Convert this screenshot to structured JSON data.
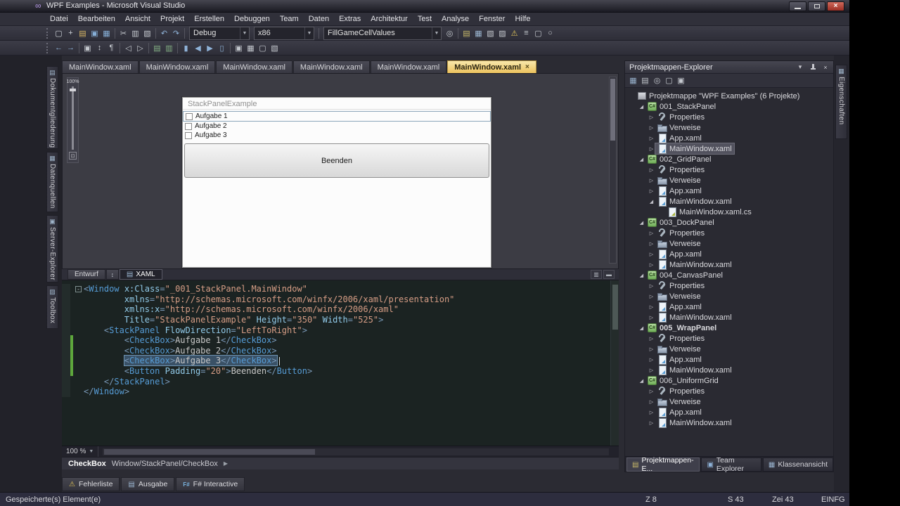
{
  "titlebar": {
    "title": "WPF Examples - Microsoft Visual Studio"
  },
  "menu": {
    "items": [
      "Datei",
      "Bearbeiten",
      "Ansicht",
      "Projekt",
      "Erstellen",
      "Debuggen",
      "Team",
      "Daten",
      "Extras",
      "Architektur",
      "Test",
      "Analyse",
      "Fenster",
      "Hilfe"
    ]
  },
  "toolbar1": {
    "left_icons": [
      {
        "name": "new-project-icon",
        "glyph": "▢",
        "color": "#cdd2d8"
      },
      {
        "name": "add-item-icon",
        "glyph": "+",
        "color": "#cdd2d8"
      },
      {
        "name": "open-file-icon",
        "glyph": "▤",
        "color": "#d9b765"
      },
      {
        "name": "save-icon",
        "glyph": "▣",
        "color": "#86aed6"
      },
      {
        "name": "save-all-icon",
        "glyph": "▦",
        "color": "#86aed6"
      },
      {
        "sep": true
      },
      {
        "name": "cut-icon",
        "glyph": "✂",
        "color": "#c4c8ce"
      },
      {
        "name": "copy-icon",
        "glyph": "▥",
        "color": "#c4c8ce"
      },
      {
        "name": "paste-icon",
        "glyph": "▧",
        "color": "#c4c8ce"
      },
      {
        "sep": true
      },
      {
        "name": "undo-icon",
        "glyph": "↶",
        "color": "#8fb3d9"
      },
      {
        "name": "redo-icon",
        "glyph": "↷",
        "color": "#8fb3d9"
      },
      {
        "sep": true
      }
    ],
    "debug_combo": "Debug",
    "platform_combo": "x86",
    "member_combo": "FillGameCellValues",
    "combo_arrow": "▼",
    "right_icons": [
      {
        "name": "find-in-files-icon",
        "glyph": "◎",
        "color": "#c4c8ce"
      },
      {
        "sep": true
      },
      {
        "name": "solution-explorer-icon",
        "glyph": "▤",
        "color": "#c9b96a"
      },
      {
        "name": "properties-window-icon",
        "glyph": "▦",
        "color": "#9ab4cf"
      },
      {
        "name": "object-browser-icon",
        "glyph": "▧",
        "color": "#c4c8ce"
      },
      {
        "name": "toolbox-icon",
        "glyph": "▨",
        "color": "#c4c8ce"
      },
      {
        "name": "error-list-icon",
        "glyph": "⚠",
        "color": "#e0c35a"
      },
      {
        "name": "output-window-icon",
        "glyph": "≡",
        "color": "#c4c8ce"
      },
      {
        "name": "immediate-window-icon",
        "glyph": "▢",
        "color": "#c4c8ce"
      },
      {
        "name": "start-page-icon",
        "glyph": "○",
        "color": "#c4c8ce"
      }
    ]
  },
  "toolbar2": {
    "icons": [
      {
        "name": "navigate-backward-icon",
        "glyph": "←",
        "color": "#8fb3d9"
      },
      {
        "name": "navigate-forward-icon",
        "glyph": "→",
        "color": "#8fb3d9"
      },
      {
        "sep": true
      },
      {
        "name": "display-in-browser-icon",
        "glyph": "▣",
        "color": "#c4c8ce"
      },
      {
        "name": "word-wrap-icon",
        "glyph": "↕",
        "color": "#c4c8ce"
      },
      {
        "name": "show-whitespace-icon",
        "glyph": "¶",
        "color": "#c4c8ce"
      },
      {
        "sep": true
      },
      {
        "name": "decrease-indent-icon",
        "glyph": "◁",
        "color": "#c4c8ce"
      },
      {
        "name": "increase-indent-icon",
        "glyph": "▷",
        "color": "#c4c8ce"
      },
      {
        "sep": true
      },
      {
        "name": "comment-icon",
        "glyph": "▤",
        "color": "#85b285"
      },
      {
        "name": "uncomment-icon",
        "glyph": "▥",
        "color": "#85b285"
      },
      {
        "sep": true
      },
      {
        "name": "toggle-bookmark-icon",
        "glyph": "▮",
        "color": "#8fb3d9"
      },
      {
        "name": "previous-bookmark-icon",
        "glyph": "◀",
        "color": "#8fb3d9"
      },
      {
        "name": "next-bookmark-icon",
        "glyph": "▶",
        "color": "#8fb3d9"
      },
      {
        "name": "clear-bookmarks-icon",
        "glyph": "▯",
        "color": "#8fb3d9"
      },
      {
        "sep": true
      },
      {
        "name": "intellisense-icon",
        "glyph": "▣",
        "color": "#c4c8ce"
      },
      {
        "name": "parameter-info-icon",
        "glyph": "▦",
        "color": "#c4c8ce"
      },
      {
        "name": "quick-info-icon",
        "glyph": "▢",
        "color": "#c4c8ce"
      },
      {
        "name": "word-completion-icon",
        "glyph": "▧",
        "color": "#c4c8ce"
      }
    ]
  },
  "doc_tabs": [
    {
      "label": "MainWindow.xaml",
      "active": false
    },
    {
      "label": "MainWindow.xaml",
      "active": false
    },
    {
      "label": "MainWindow.xaml",
      "active": false
    },
    {
      "label": "MainWindow.xaml",
      "active": false
    },
    {
      "label": "MainWindow.xaml",
      "active": false
    },
    {
      "label": "MainWindow.xaml",
      "active": true,
      "close": "×"
    }
  ],
  "designer": {
    "zoom_label": "100%",
    "fit_glyph": "⊡",
    "preview": {
      "title": "StackPanelExample",
      "checkboxes": [
        "Aufgabe 1",
        "Aufgabe 2",
        "Aufgabe 3"
      ],
      "button": "Beenden"
    }
  },
  "editor": {
    "design_tab": "Entwurf",
    "swap_glyph": "↕",
    "xaml_tab": "XAML",
    "zoom": "100 %",
    "breadcrumb": {
      "current": "CheckBox",
      "path": "Window/StackPanel/CheckBox",
      "chevron": "▶"
    },
    "code": [
      {
        "fold": "-",
        "tokens": [
          {
            "c": "d",
            "t": "<"
          },
          {
            "c": "e",
            "t": "Window"
          },
          {
            "c": "p",
            "t": " "
          },
          {
            "c": "a",
            "t": "x:Class"
          },
          {
            "c": "d",
            "t": "="
          },
          {
            "c": "s",
            "t": "\"_001_StackPanel.MainWindow\""
          }
        ]
      },
      {
        "tokens": [
          {
            "c": "p",
            "t": "        "
          },
          {
            "c": "a",
            "t": "xmlns"
          },
          {
            "c": "d",
            "t": "="
          },
          {
            "c": "s",
            "t": "\"http://schemas.microsoft.com/winfx/2006/xaml/presentation\""
          }
        ]
      },
      {
        "tokens": [
          {
            "c": "p",
            "t": "        "
          },
          {
            "c": "a",
            "t": "xmlns:x"
          },
          {
            "c": "d",
            "t": "="
          },
          {
            "c": "s",
            "t": "\"http://schemas.microsoft.com/winfx/2006/xaml\""
          }
        ]
      },
      {
        "tokens": [
          {
            "c": "p",
            "t": "        "
          },
          {
            "c": "a",
            "t": "Title"
          },
          {
            "c": "d",
            "t": "="
          },
          {
            "c": "s",
            "t": "\"StackPanelExample\""
          },
          {
            "c": "p",
            "t": " "
          },
          {
            "c": "a",
            "t": "Height"
          },
          {
            "c": "d",
            "t": "="
          },
          {
            "c": "s",
            "t": "\"350\""
          },
          {
            "c": "p",
            "t": " "
          },
          {
            "c": "a",
            "t": "Width"
          },
          {
            "c": "d",
            "t": "="
          },
          {
            "c": "s",
            "t": "\"525\""
          },
          {
            "c": "d",
            "t": ">"
          }
        ]
      },
      {
        "tokens": [
          {
            "c": "p",
            "t": "    "
          },
          {
            "c": "d",
            "t": "<"
          },
          {
            "c": "e",
            "t": "StackPanel"
          },
          {
            "c": "p",
            "t": " "
          },
          {
            "c": "a",
            "t": "FlowDirection"
          },
          {
            "c": "d",
            "t": "="
          },
          {
            "c": "s",
            "t": "\"LeftToRight\""
          },
          {
            "c": "d",
            "t": ">"
          }
        ]
      },
      {
        "chg": true,
        "tokens": [
          {
            "c": "p",
            "t": "        "
          },
          {
            "c": "d",
            "t": "<"
          },
          {
            "c": "e",
            "t": "CheckBox"
          },
          {
            "c": "d",
            "t": ">"
          },
          {
            "c": "x",
            "t": "Aufgabe 1"
          },
          {
            "c": "d",
            "t": "</"
          },
          {
            "c": "e",
            "t": "CheckBox"
          },
          {
            "c": "d",
            "t": ">"
          }
        ]
      },
      {
        "chg": true,
        "tokens": [
          {
            "c": "p",
            "t": "        "
          },
          {
            "c": "d",
            "t": "<"
          },
          {
            "c": "e",
            "t": "CheckBox"
          },
          {
            "c": "d",
            "t": ">"
          },
          {
            "c": "x",
            "t": "Aufgabe 2"
          },
          {
            "c": "d",
            "t": "</"
          },
          {
            "c": "e",
            "t": "CheckBox"
          },
          {
            "c": "d",
            "t": ">"
          }
        ]
      },
      {
        "chg": true,
        "caret": true,
        "tokens": [
          {
            "c": "p",
            "t": "        "
          },
          {
            "c": "d",
            "t": "<",
            "sel": true
          },
          {
            "c": "e",
            "t": "CheckBox",
            "sel": true
          },
          {
            "c": "d",
            "t": ">",
            "sel": true
          },
          {
            "c": "x",
            "t": "Aufgabe 3",
            "sel": true
          },
          {
            "c": "d",
            "t": "</",
            "sel": true
          },
          {
            "c": "e",
            "t": "CheckBox",
            "sel": true
          },
          {
            "c": "d",
            "t": ">",
            "sel": true
          }
        ]
      },
      {
        "chg": true,
        "tokens": [
          {
            "c": "p",
            "t": "        "
          },
          {
            "c": "d",
            "t": "<"
          },
          {
            "c": "e",
            "t": "Button"
          },
          {
            "c": "p",
            "t": " "
          },
          {
            "c": "a",
            "t": "Padding"
          },
          {
            "c": "d",
            "t": "="
          },
          {
            "c": "s",
            "t": "\"20\""
          },
          {
            "c": "d",
            "t": ">"
          },
          {
            "c": "x",
            "t": "Beenden"
          },
          {
            "c": "d",
            "t": "</"
          },
          {
            "c": "e",
            "t": "Button"
          },
          {
            "c": "d",
            "t": ">"
          }
        ]
      },
      {
        "tokens": [
          {
            "c": "p",
            "t": "    "
          },
          {
            "c": "d",
            "t": "</"
          },
          {
            "c": "e",
            "t": "StackPanel"
          },
          {
            "c": "d",
            "t": ">"
          }
        ]
      },
      {
        "tokens": [
          {
            "c": "d",
            "t": "</"
          },
          {
            "c": "e",
            "t": "Window"
          },
          {
            "c": "d",
            "t": ">"
          }
        ]
      }
    ]
  },
  "solution_explorer": {
    "title": "Projektmappen-Explorer",
    "header_icons": {
      "dropdown": "▾",
      "close": "×"
    },
    "toolbar_icons": [
      {
        "name": "properties-icon",
        "glyph": "▦",
        "color": "#9ab4cf"
      },
      {
        "name": "show-all-files-icon",
        "glyph": "▤",
        "color": "#c4c8ce"
      },
      {
        "name": "refresh-icon",
        "glyph": "◎",
        "color": "#c4c8ce"
      },
      {
        "name": "view-code-icon",
        "glyph": "▢",
        "color": "#c4c8ce"
      },
      {
        "name": "view-designer-icon",
        "glyph": "▣",
        "color": "#c4c8ce"
      }
    ],
    "tree": [
      {
        "label": "Projektmappe \"WPF Examples\" (6 Projekte)",
        "level": 0,
        "icon": "solution",
        "expand": "none"
      },
      {
        "label": "001_StackPanel",
        "level": 1,
        "icon": "project",
        "expand": "expanded"
      },
      {
        "label": "Properties",
        "level": 2,
        "icon": "properties",
        "expand": "collapsed"
      },
      {
        "label": "Verweise",
        "level": 2,
        "icon": "references",
        "expand": "collapsed"
      },
      {
        "label": "App.xaml",
        "level": 2,
        "icon": "xaml",
        "expand": "collapsed"
      },
      {
        "label": "MainWindow.xaml",
        "level": 2,
        "icon": "xaml",
        "expand": "collapsed",
        "selected": true
      },
      {
        "label": "002_GridPanel",
        "level": 1,
        "icon": "project",
        "expand": "expanded"
      },
      {
        "label": "Properties",
        "level": 2,
        "icon": "properties",
        "expand": "collapsed"
      },
      {
        "label": "Verweise",
        "level": 2,
        "icon": "references",
        "expand": "collapsed"
      },
      {
        "label": "App.xaml",
        "level": 2,
        "icon": "xaml",
        "expand": "collapsed"
      },
      {
        "label": "MainWindow.xaml",
        "level": 2,
        "icon": "xaml",
        "expand": "expanded"
      },
      {
        "label": "MainWindow.xaml.cs",
        "level": 3,
        "icon": "cs",
        "expand": "none"
      },
      {
        "label": "003_DockPanel",
        "level": 1,
        "icon": "project",
        "expand": "expanded"
      },
      {
        "label": "Properties",
        "level": 2,
        "icon": "properties",
        "expand": "collapsed"
      },
      {
        "label": "Verweise",
        "level": 2,
        "icon": "references",
        "expand": "collapsed"
      },
      {
        "label": "App.xaml",
        "level": 2,
        "icon": "xaml",
        "expand": "collapsed"
      },
      {
        "label": "MainWindow.xaml",
        "level": 2,
        "icon": "xaml",
        "expand": "collapsed"
      },
      {
        "label": "004_CanvasPanel",
        "level": 1,
        "icon": "project",
        "expand": "expanded"
      },
      {
        "label": "Properties",
        "level": 2,
        "icon": "properties",
        "expand": "collapsed"
      },
      {
        "label": "Verweise",
        "level": 2,
        "icon": "references",
        "expand": "collapsed"
      },
      {
        "label": "App.xaml",
        "level": 2,
        "icon": "xaml",
        "expand": "collapsed"
      },
      {
        "label": "MainWindow.xaml",
        "level": 2,
        "icon": "xaml",
        "expand": "collapsed"
      },
      {
        "label": "005_WrapPanel",
        "level": 1,
        "icon": "project",
        "expand": "expanded",
        "bold": true
      },
      {
        "label": "Properties",
        "level": 2,
        "icon": "properties",
        "expand": "collapsed"
      },
      {
        "label": "Verweise",
        "level": 2,
        "icon": "references",
        "expand": "collapsed"
      },
      {
        "label": "App.xaml",
        "level": 2,
        "icon": "xaml",
        "expand": "collapsed"
      },
      {
        "label": "MainWindow.xaml",
        "level": 2,
        "icon": "xaml",
        "expand": "collapsed"
      },
      {
        "label": "006_UniformGrid",
        "level": 1,
        "icon": "project",
        "expand": "expanded"
      },
      {
        "label": "Properties",
        "level": 2,
        "icon": "properties",
        "expand": "collapsed"
      },
      {
        "label": "Verweise",
        "level": 2,
        "icon": "references",
        "expand": "collapsed"
      },
      {
        "label": "App.xaml",
        "level": 2,
        "icon": "xaml",
        "expand": "collapsed"
      },
      {
        "label": "MainWindow.xaml",
        "level": 2,
        "icon": "xaml",
        "expand": "collapsed"
      }
    ],
    "bottom_tabs": [
      {
        "label": "Projektmappen-E...",
        "active": true
      },
      {
        "label": "Team Explorer",
        "active": false
      },
      {
        "label": "Klassenansicht",
        "active": false
      }
    ]
  },
  "left_tool_tabs": [
    "Dokumentgliederung",
    "Datenquellen",
    "Server-Explorer",
    "Toolbox"
  ],
  "right_tool_tabs": [
    "Eigenschaften"
  ],
  "bottom_tool_tabs": [
    {
      "label": "Fehlerliste"
    },
    {
      "label": "Ausgabe"
    },
    {
      "label": "F# Interactive"
    }
  ],
  "statusbar": {
    "left": "Gespeicherte(s) Element(e)",
    "line": "Z 8",
    "col": "S 43",
    "char": "Zei 43",
    "mode": "EINFG"
  }
}
